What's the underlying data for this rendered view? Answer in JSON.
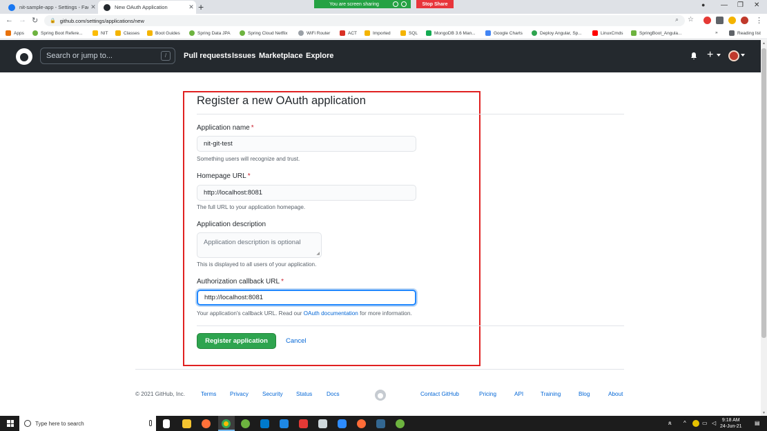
{
  "browser": {
    "tabs": [
      {
        "title": "nit-sample-app - Settings - Faceb",
        "active": false
      },
      {
        "title": "New OAuth Application",
        "active": true
      }
    ],
    "share_text": "You are screen sharing",
    "stop_share_label": "Stop Share",
    "url": "github.com/settings/applications/new",
    "bookmarks": [
      "Apps",
      "Spring Boot Refere...",
      "NIT",
      "Classes",
      "Boot Guides",
      "Spring Data JPA",
      "Spring Cloud Netflix",
      "WiFi Router",
      "ACT",
      "Imported",
      "SQL",
      "MongoDB 3.6 Man...",
      "Google Charts",
      "Deploy Angular, Sp...",
      "LinuxCmds",
      "SpringBoot_Angula..."
    ],
    "reading_list": "Reading list"
  },
  "header": {
    "search_placeholder": "Search or jump to...",
    "search_shortcut": "/",
    "nav": [
      "Pull requests",
      "Issues",
      "Marketplace",
      "Explore"
    ]
  },
  "form": {
    "title": "Register a new OAuth application",
    "fields": {
      "app_name": {
        "label": "Application name",
        "value": "nit-git-test",
        "note": "Something users will recognize and trust."
      },
      "homepage": {
        "label": "Homepage URL",
        "value": "http://localhost:8081",
        "note": "The full URL to your application homepage."
      },
      "description": {
        "label": "Application description",
        "placeholder": "Application description is optional",
        "note": "This is displayed to all users of your application."
      },
      "callback": {
        "label": "Authorization callback URL",
        "value": "http://localhost:8081",
        "note_before": "Your application's callback URL. Read our ",
        "note_link": "OAuth documentation",
        "note_after": " for more information."
      }
    },
    "required_mark": "*",
    "register_label": "Register application",
    "cancel_label": "Cancel"
  },
  "footer": {
    "copyright": "© 2021 GitHub, Inc.",
    "left_links": [
      "Terms",
      "Privacy",
      "Security",
      "Status",
      "Docs"
    ],
    "right_links": [
      "Contact GitHub",
      "Pricing",
      "API",
      "Training",
      "Blog",
      "About"
    ]
  },
  "taskbar": {
    "search_placeholder": "Type here to search",
    "time": "9:18 AM",
    "date": "24-Jun-21"
  }
}
